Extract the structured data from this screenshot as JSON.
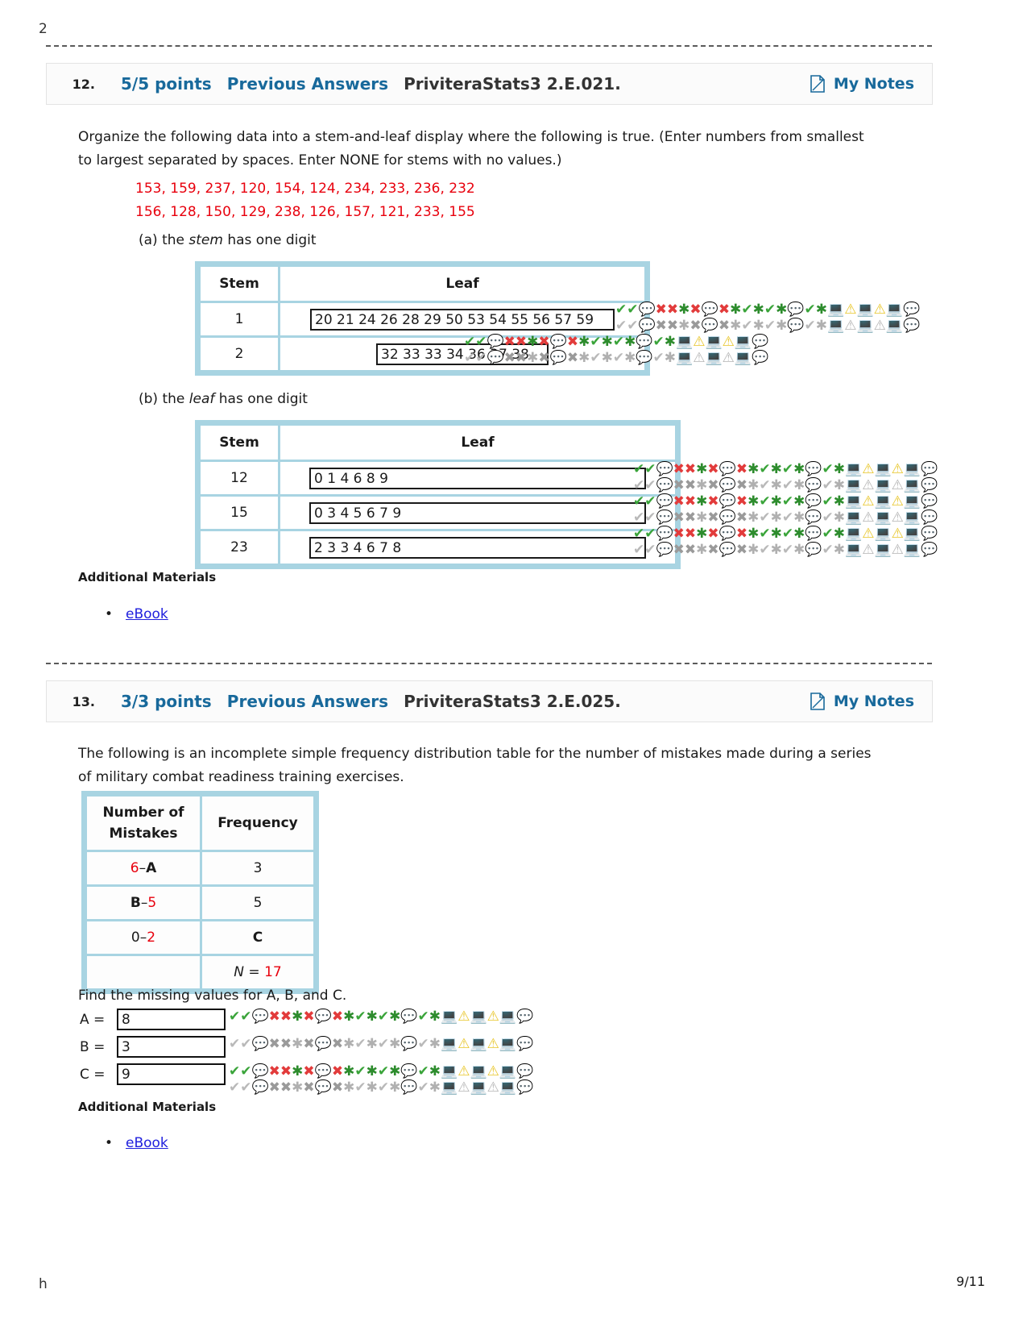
{
  "page": {
    "top_partial_char": "2",
    "bottom_partial_char": "h",
    "page_number": "9/11"
  },
  "questions": [
    {
      "number": "12.",
      "points": "5/5 points",
      "previous_answers": "Previous Answers",
      "code": "PriviteraStats3 2.E.021.",
      "my_notes": "My Notes",
      "prompt_line1": "Organize the following data into a stem-and-leaf display where the following is true. (Enter numbers from smallest",
      "prompt_line2": "to largest separated by spaces. Enter NONE for stems with no values.)",
      "data_row1": "153, 159, 237, 120, 154, 124, 234, 233, 236, 232",
      "data_row2": "156, 128, 150, 129, 238, 126, 157, 121, 233, 155",
      "part_a_label_pre": "(a) the ",
      "part_a_label_em": "stem",
      "part_a_label_post": " has one digit",
      "part_b_label_pre": "(b) the ",
      "part_b_label_em": "leaf",
      "part_b_label_post": " has one digit",
      "table_a": {
        "headers": [
          "Stem",
          "Leaf"
        ],
        "rows": [
          {
            "stem": "1",
            "leaf": "20 21 24 26 28 29 50 53 54 55 56 57 59"
          },
          {
            "stem": "2",
            "leaf": "32 33 33 34 36 37 38"
          }
        ]
      },
      "table_b": {
        "headers": [
          "Stem",
          "Leaf"
        ],
        "rows": [
          {
            "stem": "12",
            "leaf": "0 1 4 6 8 9"
          },
          {
            "stem": "15",
            "leaf": "0 3 4 5 6 7 9"
          },
          {
            "stem": "23",
            "leaf": "2 3 3 4 6 7 8"
          }
        ]
      },
      "additional_materials": "Additional Materials",
      "ebook": "eBook"
    },
    {
      "number": "13.",
      "points": "3/3 points",
      "previous_answers": "Previous Answers",
      "code": "PriviteraStats3 2.E.025.",
      "my_notes": "My Notes",
      "prompt_line1": "The following is an incomplete simple frequency distribution table for the number of mistakes made during a series",
      "prompt_line2": "of military combat readiness training exercises.",
      "freq_table": {
        "header_col1_line1": "Number of",
        "header_col1_line2": "Mistakes",
        "header_col2": "Frequency",
        "rows": [
          {
            "mistakes_red": "6",
            "mistakes_dash": "–",
            "mistakes_bold": "A",
            "mistakes_order": "red-first",
            "frequency": "3",
            "frequency_style": "red"
          },
          {
            "mistakes_bold": "B",
            "mistakes_dash": "–",
            "mistakes_red": "5",
            "mistakes_order": "bold-first",
            "frequency": "5",
            "frequency_style": "red"
          },
          {
            "mistakes_black": "0",
            "mistakes_dash": "–",
            "mistakes_red": "2",
            "mistakes_order": "black-first",
            "frequency": "C",
            "frequency_style": "bold"
          },
          {
            "mistakes_blank": "",
            "frequency_n_label": "N",
            "frequency_eq": " = ",
            "frequency_n_value": "17",
            "frequency_style": "n-total"
          }
        ]
      },
      "find_text": "Find the missing values for A, B, and C.",
      "answers": [
        {
          "label": "A =",
          "value": "8"
        },
        {
          "label": "B =",
          "value": "3"
        },
        {
          "label": "C =",
          "value": "9"
        }
      ],
      "additional_materials": "Additional Materials",
      "ebook": "eBook"
    }
  ],
  "icons": {
    "note_icon": "note-page-icon",
    "check": "✔",
    "cross": "✖",
    "star": "★",
    "bubble": "◗",
    "computer": "▣",
    "warning": "⚠"
  },
  "colors": {
    "link_blue": "#18699b",
    "ebook_blue": "#2020dd",
    "data_red": "#e8000d",
    "table_border": "#a8d4e2",
    "check_green": "#3aa43a",
    "cross_red": "#e23b3b"
  }
}
